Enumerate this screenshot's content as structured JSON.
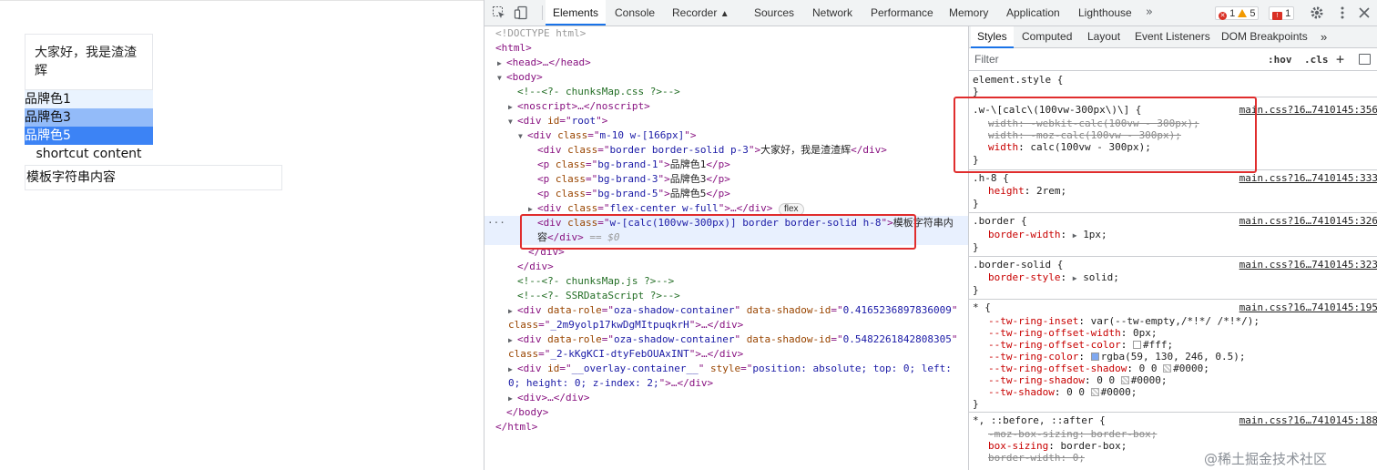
{
  "preview": {
    "box_text": "大家好，我是渣渣辉",
    "brand1": "品牌色1",
    "brand3": "品牌色3",
    "brand5": "品牌色5",
    "shortcut": "shortcut content",
    "template": "模板字符串内容"
  },
  "devtools": {
    "tabs": [
      "Elements",
      "Console",
      "Recorder",
      "Sources",
      "Network",
      "Performance",
      "Memory",
      "Application",
      "Lighthouse"
    ],
    "more": "»",
    "errors": "1",
    "warnings": "5",
    "issues": "1"
  },
  "tree": [
    "<!DOCTYPE html>",
    "<html>",
    "<head>…</head>",
    "<body>",
    "<!--<?- chunksMap.css ?>-->",
    "<noscript>…</noscript>",
    "<div id=\"root\">",
    "<div class=\"m-10 w-[166px]\">",
    "<div class=\"border border-solid p-3\">大家好，我是渣渣辉</div>",
    "<p class=\"bg-brand-1\">品牌色1</p>",
    "<p class=\"bg-brand-3\">品牌色3</p>",
    "<p class=\"bg-brand-5\">品牌色5</p>",
    "<div class=\"flex-center w-full\">…</div>",
    "<div class=\"w-[calc(100vw-300px)] border border-solid h-8\">模板字符串内",
    "容</div> == $0",
    "</div>",
    "</div>",
    "<!--<?- chunksMap.js ?>-->",
    "<!--<?- SSRDataScript ?>-->",
    "<div data-role=\"oza-shadow-container\" data-shadow-id=\"0.4165236897836009\"",
    "class=\"_2m9yolp17kwDgMItpuqkrH\">…</div>",
    "<div data-role=\"oza-shadow-container\" data-shadow-id=\"0.5482261842808305\"",
    "class=\"_2-kKgKCI-dtyFebOUAxINT\">…</div>",
    "<div id=\"__overlay-container__\" style=\"position: absolute; top: 0; left:",
    "0; height: 0; z-index: 2;\">…</div>",
    "<div>…</div>",
    "</body>",
    "</html>"
  ],
  "flex_badge": "flex",
  "styles": {
    "subtabs": [
      "Styles",
      "Computed",
      "Layout",
      "Event Listeners",
      "DOM Breakpoints"
    ],
    "subtabs_more": "»",
    "filter_placeholder": "Filter",
    "hov": ":hov",
    "cls": ".cls",
    "add": "+",
    "element_style": "element.style {",
    "close": "}",
    "rules": {
      "w_calc": {
        "selector": ".w-\\[calc\\(100vw-300px\\)\\] {",
        "source": "main.css?16…7410145:356",
        "d1": "width: -webkit-calc(100vw - 300px);",
        "d2": "width: -moz-calc(100vw - 300px);",
        "d3_name": "width",
        "d3_value": "calc(100vw - 300px);"
      },
      "h8": {
        "selector": ".h-8 {",
        "source": "main.css?16…7410145:333",
        "name": "height",
        "value": "2rem;"
      },
      "border": {
        "selector": ".border {",
        "source": "main.css?16…7410145:326",
        "name": "border-width",
        "value": "1px;"
      },
      "border_solid": {
        "selector": ".border-solid {",
        "source": "main.css?16…7410145:323",
        "name": "border-style",
        "value": "solid;"
      },
      "star": {
        "selector": "* {",
        "source": "main.css?16…7410145:195",
        "decls": [
          {
            "name": "--tw-ring-inset",
            "value": "var(--tw-empty,/*!*/ /*!*/);"
          },
          {
            "name": "--tw-ring-offset-width",
            "value": "0px;"
          },
          {
            "name": "--tw-ring-offset-color",
            "value": "#fff;"
          },
          {
            "name": "--tw-ring-color",
            "value": "rgba(59, 130, 246, 0.5);"
          },
          {
            "name": "--tw-ring-offset-shadow",
            "value": "0 0 #0000;"
          },
          {
            "name": "--tw-ring-shadow",
            "value": "0 0 #0000;"
          },
          {
            "name": "--tw-shadow",
            "value": "0 0 #0000;"
          }
        ]
      },
      "star_before": {
        "selector": "*, ::before, ::after {",
        "source": "main.css?16…7410145:188",
        "d1": "-moz-box-sizing: border-box;",
        "d2_name": "box-sizing",
        "d2_value": "border-box;",
        "d3": "border-width: 0;"
      }
    },
    "watermark": "@稀土掘金技术社区"
  },
  "colors": {
    "brand1": "#eaf3fe",
    "brand3": "#93bbf9",
    "brand5": "#3c83f5",
    "highlight": "#e02d2d",
    "ring_color": "#3b82f6"
  }
}
